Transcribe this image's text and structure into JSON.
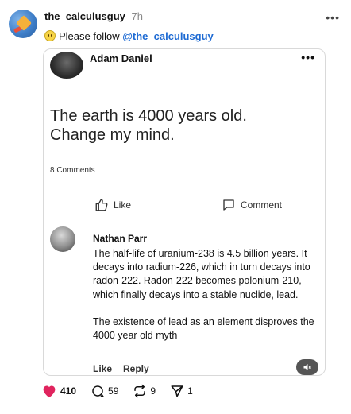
{
  "post": {
    "username": "the_calculusguy",
    "time": "7h",
    "subline_prefix": "Please follow",
    "mention": "@the_calculusguy",
    "more_icon": "more-horizontal-icon"
  },
  "embedded": {
    "author": "Adam Daniel",
    "text": "The earth is 4000 years old.\nChange my mind.",
    "comments_count": "8 Comments",
    "like_label": "Like",
    "comment_label": "Comment",
    "reply": {
      "author": "Nathan Parr",
      "text": "The half-life of uranium-238 is 4.5 billion years. It decays into radium-226, which in turn decays into radon-222. Radon-222 becomes polonium-210, which finally decays into a stable nuclide, lead.\n\nThe existence of lead as an element disproves the 4000 year old myth",
      "like_label": "Like",
      "reply_label": "Reply"
    }
  },
  "footer": {
    "likes": "410",
    "comments": "59",
    "reposts": "9",
    "shares": "1"
  },
  "colors": {
    "heart": "#e0245e",
    "mention": "#1d6ad3",
    "time": "#8a8a8a"
  }
}
